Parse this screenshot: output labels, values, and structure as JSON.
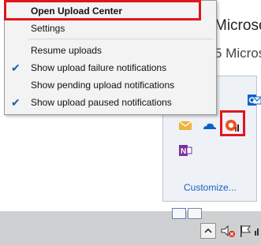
{
  "background_window": {
    "title_fragment": "Microso",
    "subtitle_fragment": "5 Microso"
  },
  "context_menu": {
    "items": [
      {
        "label": "Open Upload Center",
        "checked": false,
        "bold": true
      },
      {
        "label": "Settings",
        "checked": false,
        "bold": false
      },
      {
        "label": "Resume uploads",
        "checked": false,
        "bold": false
      },
      {
        "label": "Show upload failure notifications",
        "checked": true,
        "bold": false
      },
      {
        "label": "Show pending upload notifications",
        "checked": false,
        "bold": false
      },
      {
        "label": "Show upload paused notifications",
        "checked": true,
        "bold": false
      }
    ],
    "check_glyph": "✔"
  },
  "tray_flyout": {
    "icons": [
      "outlook-icon",
      "mail-icon",
      "onedrive-icon",
      "office-upload-center-icon",
      "onenote-icon"
    ],
    "customize_label": "Customize..."
  },
  "colors": {
    "highlight": "#e0161e",
    "link": "#1b5fc1",
    "check": "#1d5ea8"
  }
}
